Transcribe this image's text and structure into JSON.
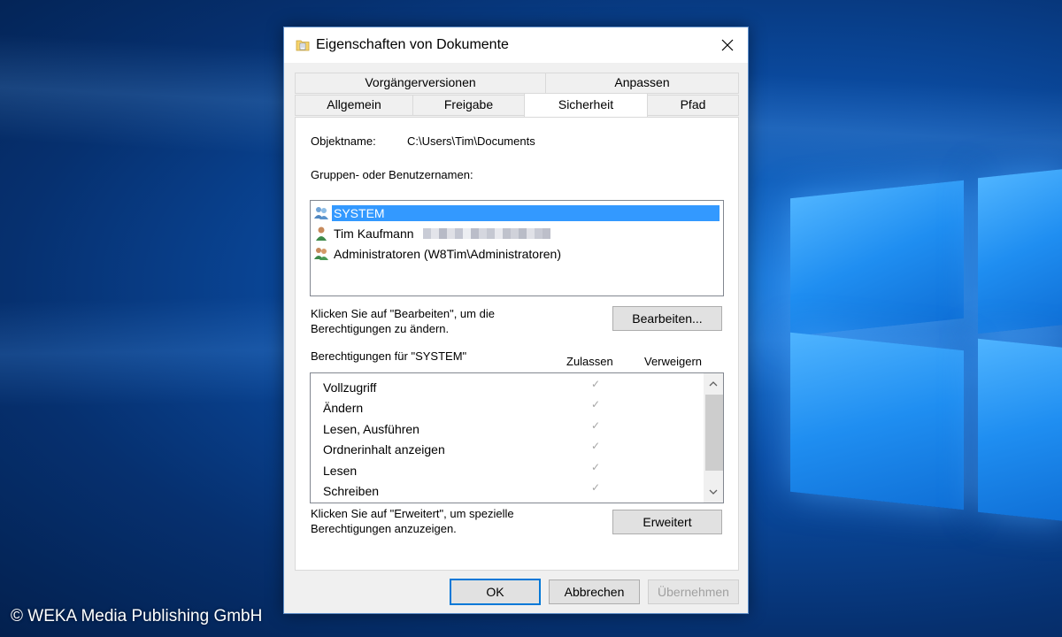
{
  "window": {
    "title": "Eigenschaften von Dokumente"
  },
  "tabs": {
    "row1": [
      "Vorgängerversionen",
      "Anpassen"
    ],
    "row2": [
      "Allgemein",
      "Freigabe",
      "Sicherheit",
      "Pfad"
    ],
    "active": "Sicherheit"
  },
  "security": {
    "object_label": "Objektname:",
    "object_value": "C:\\Users\\Tim\\Documents",
    "groups_label": "Gruppen- oder Benutzernamen:",
    "users": [
      {
        "name": "SYSTEM",
        "icon": "group-user-icon",
        "selected": true
      },
      {
        "name": "Tim Kaufmann",
        "icon": "single-user-icon",
        "selected": false
      },
      {
        "name": "Administratoren (W8Tim\\Administratoren)",
        "icon": "group-user-icon",
        "selected": false
      }
    ],
    "edit_hint": "Klicken Sie auf \"Bearbeiten\", um die Berechtigungen zu ändern.",
    "edit_button": "Bearbeiten...",
    "permissions_label": "Berechtigungen für \"SYSTEM\"",
    "col_allow": "Zulassen",
    "col_deny": "Verweigern",
    "permissions": [
      {
        "name": "Vollzugriff",
        "allow": true,
        "deny": false
      },
      {
        "name": "Ändern",
        "allow": true,
        "deny": false
      },
      {
        "name": "Lesen, Ausführen",
        "allow": true,
        "deny": false
      },
      {
        "name": "Ordnerinhalt anzeigen",
        "allow": true,
        "deny": false
      },
      {
        "name": "Lesen",
        "allow": true,
        "deny": false
      },
      {
        "name": "Schreiben",
        "allow": true,
        "deny": false
      }
    ],
    "check_glyph": "✓",
    "advanced_hint": "Klicken Sie auf \"Erweitert\", um spezielle Berechtigungen anzuzeigen.",
    "advanced_button": "Erweitert"
  },
  "footer": {
    "ok": "OK",
    "cancel": "Abbrechen",
    "apply": "Übernehmen"
  },
  "watermark": "© WEKA Media Publishing GmbH",
  "colors": {
    "selection": "#3399ff",
    "accent_border": "#0078d7"
  }
}
